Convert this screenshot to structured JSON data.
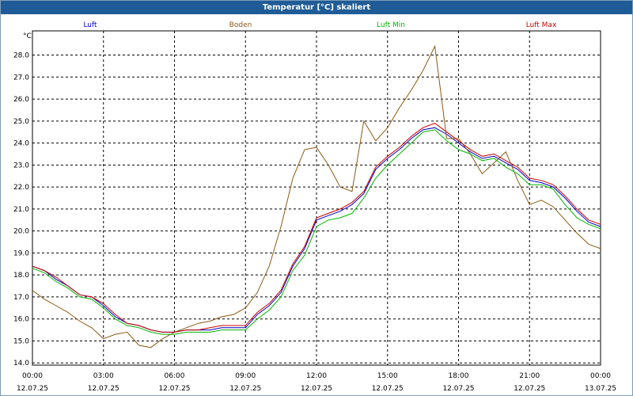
{
  "window": {
    "title": "Temperatur [°C] skaliert"
  },
  "chart_data": {
    "type": "line",
    "title": "Temperatur [°C] skaliert",
    "ylabel": "°C",
    "ylim": [
      13.9,
      29.1
    ],
    "xlim": [
      0,
      24
    ],
    "y_ticks": [
      "14.0",
      "15.0",
      "16.0",
      "17.0",
      "18.0",
      "19.0",
      "20.0",
      "21.0",
      "22.0",
      "23.0",
      "24.0",
      "25.0",
      "26.0",
      "27.0",
      "28.0"
    ],
    "x_ticks": [
      {
        "time": "00:00",
        "date": "12.07.25"
      },
      {
        "time": "03:00",
        "date": "12.07.25"
      },
      {
        "time": "06:00",
        "date": "12.07.25"
      },
      {
        "time": "09:00",
        "date": "12.07.25"
      },
      {
        "time": "12:00",
        "date": "12.07.25"
      },
      {
        "time": "15:00",
        "date": "12.07.25"
      },
      {
        "time": "18:00",
        "date": "12.07.25"
      },
      {
        "time": "21:00",
        "date": "12.07.25"
      },
      {
        "time": "00:00",
        "date": "13.07.25"
      }
    ],
    "grid": true,
    "legend_position": "top",
    "x": [
      0,
      0.5,
      1,
      1.5,
      2,
      2.5,
      3,
      3.5,
      4,
      4.5,
      5,
      5.5,
      6,
      6.5,
      7,
      7.5,
      8,
      8.5,
      9,
      9.5,
      10,
      10.5,
      11,
      11.5,
      12,
      12.5,
      13,
      13.5,
      14,
      14.5,
      15,
      15.5,
      16,
      16.5,
      17,
      17.5,
      18,
      18.5,
      19,
      19.5,
      20,
      20.5,
      21,
      21.5,
      22,
      22.5,
      23,
      23.5,
      24
    ],
    "series": [
      {
        "name": "Luft",
        "color": "#0000c8",
        "values": [
          18.4,
          18.2,
          17.8,
          17.5,
          17.1,
          17.0,
          16.6,
          16.1,
          15.8,
          15.7,
          15.5,
          15.4,
          15.4,
          15.5,
          15.5,
          15.5,
          15.6,
          15.6,
          15.6,
          16.2,
          16.6,
          17.2,
          18.4,
          19.2,
          20.5,
          20.7,
          20.9,
          21.2,
          21.7,
          22.8,
          23.3,
          23.7,
          24.2,
          24.6,
          24.7,
          24.4,
          24.0,
          23.6,
          23.3,
          23.4,
          23.1,
          22.8,
          22.3,
          22.2,
          22.0,
          21.5,
          20.9,
          20.4,
          20.2
        ]
      },
      {
        "name": "Boden",
        "color": "#8b5a14",
        "values": [
          17.3,
          16.9,
          16.6,
          16.3,
          15.9,
          15.6,
          15.1,
          15.3,
          15.4,
          14.8,
          14.7,
          15.1,
          15.4,
          15.6,
          15.8,
          15.9,
          16.1,
          16.2,
          16.5,
          17.2,
          18.4,
          20.2,
          22.4,
          23.7,
          23.8,
          23.0,
          22.0,
          21.8,
          25.0,
          24.1,
          24.7,
          25.6,
          26.4,
          27.3,
          28.4,
          24.2,
          24.2,
          23.5,
          22.6,
          23.1,
          23.6,
          22.3,
          21.2,
          21.4,
          21.1,
          20.5,
          19.9,
          19.4,
          19.2
        ]
      },
      {
        "name": "Luft Min",
        "color": "#00b400",
        "values": [
          18.3,
          18.1,
          17.7,
          17.4,
          17.0,
          16.9,
          16.5,
          16.0,
          15.7,
          15.6,
          15.4,
          15.3,
          15.3,
          15.4,
          15.4,
          15.4,
          15.5,
          15.5,
          15.5,
          16.0,
          16.4,
          17.0,
          18.2,
          18.9,
          20.2,
          20.5,
          20.6,
          20.8,
          21.5,
          22.4,
          23.0,
          23.5,
          24.0,
          24.5,
          24.6,
          24.1,
          23.7,
          23.5,
          23.2,
          23.3,
          22.9,
          22.6,
          22.1,
          22.1,
          21.9,
          21.2,
          20.6,
          20.3,
          20.1
        ]
      },
      {
        "name": "Luft Max",
        "color": "#c80000",
        "values": [
          18.4,
          18.2,
          17.9,
          17.5,
          17.1,
          17.0,
          16.7,
          16.2,
          15.8,
          15.7,
          15.5,
          15.4,
          15.4,
          15.5,
          15.5,
          15.6,
          15.7,
          15.7,
          15.7,
          16.3,
          16.7,
          17.3,
          18.5,
          19.3,
          20.6,
          20.8,
          21.0,
          21.3,
          21.8,
          22.9,
          23.4,
          23.8,
          24.3,
          24.7,
          24.9,
          24.5,
          24.1,
          23.7,
          23.4,
          23.5,
          23.2,
          22.9,
          22.4,
          22.3,
          22.1,
          21.6,
          21.0,
          20.5,
          20.3
        ]
      }
    ]
  }
}
